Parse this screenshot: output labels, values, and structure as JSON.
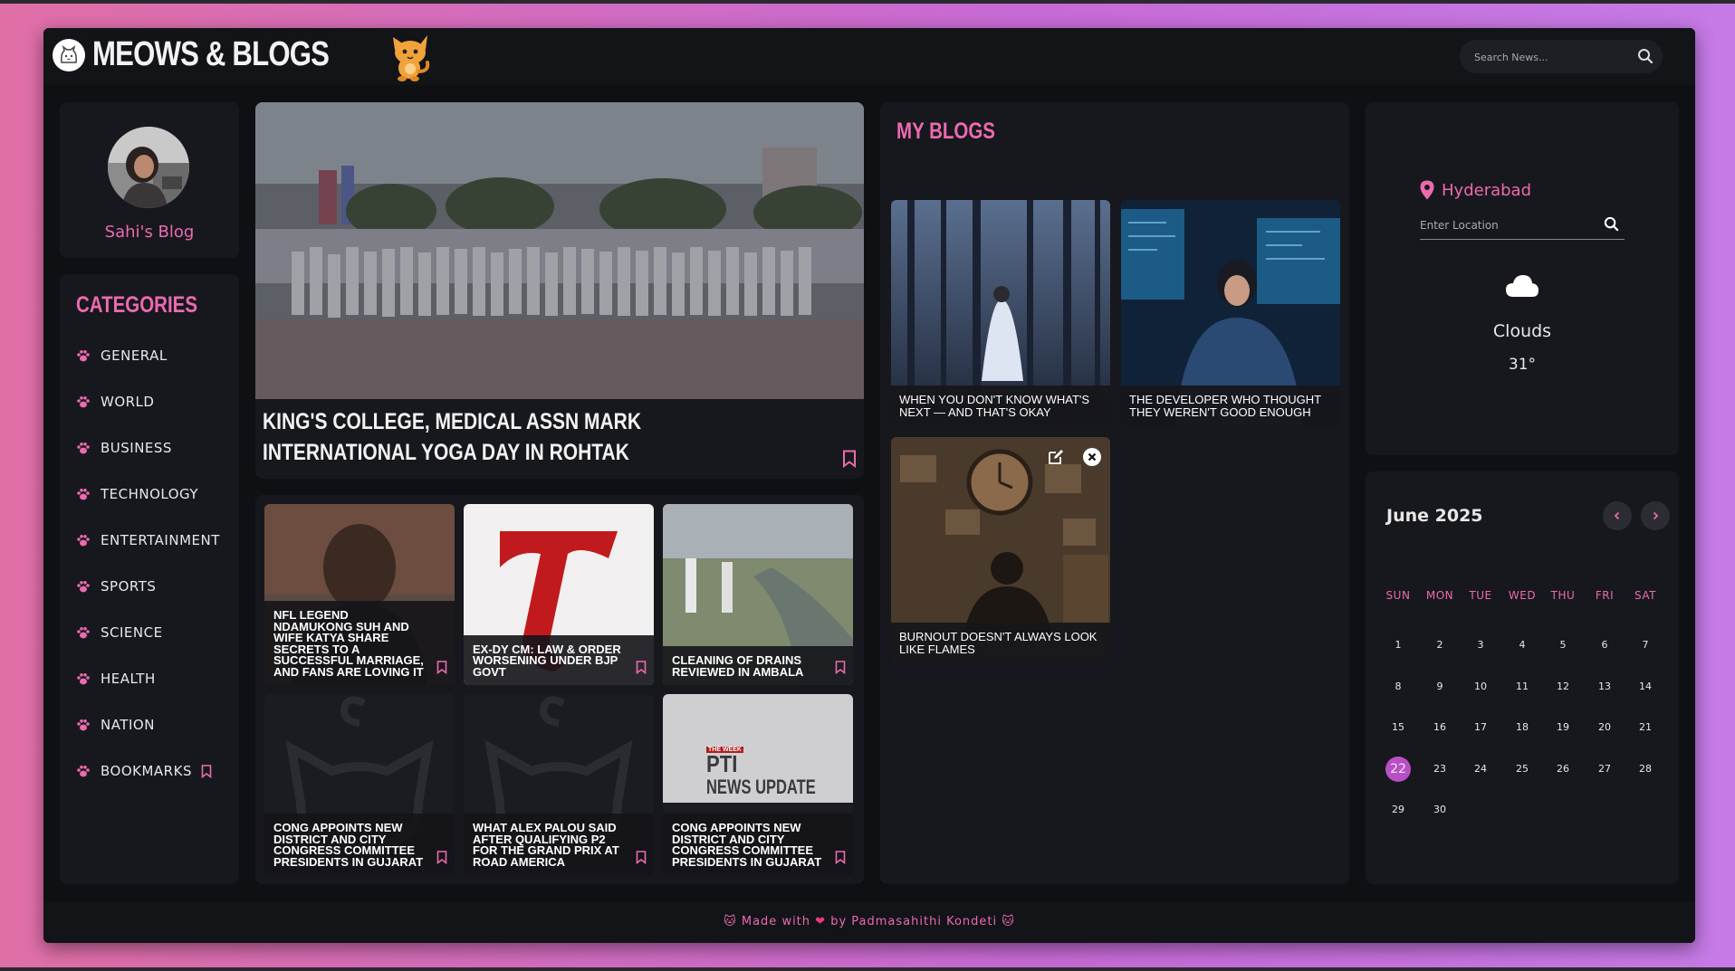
{
  "header": {
    "brand": "MEOWS & BLOGS",
    "search_placeholder": "Search News..."
  },
  "profile": {
    "name": "Sahi's Blog"
  },
  "categories": {
    "title": "CATEGORIES",
    "items": [
      {
        "label": "GENERAL"
      },
      {
        "label": "WORLD"
      },
      {
        "label": "BUSINESS"
      },
      {
        "label": "TECHNOLOGY"
      },
      {
        "label": "ENTERTAINMENT"
      },
      {
        "label": "SPORTS"
      },
      {
        "label": "SCIENCE"
      },
      {
        "label": "HEALTH"
      },
      {
        "label": "NATION"
      },
      {
        "label": "BOOKMARKS"
      }
    ]
  },
  "hero": {
    "title": "KING'S COLLEGE, MEDICAL ASSN MARK INTERNATIONAL YOGA DAY IN ROHTAK"
  },
  "news_cards": [
    {
      "title": "NFL LEGEND NDAMUKONG SUH AND WIFE KATYA SHARE SECRETS TO A SUCCESSFUL MARRIAGE, AND FANS ARE LOVING IT"
    },
    {
      "title": "EX-DY CM: LAW & ORDER WORSENING UNDER BJP GOVT"
    },
    {
      "title": "CLEANING OF DRAINS REVIEWED IN AMBALA"
    },
    {
      "title": "CONG APPOINTS NEW DISTRICT AND CITY CONGRESS COMMITTEE PRESIDENTS IN GUJARAT"
    },
    {
      "title": "WHAT ALEX PALOU SAID AFTER QUALIFYING P2 FOR THE GRAND PRIX AT ROAD AMERICA"
    },
    {
      "title": "CONG APPOINTS NEW DISTRICT AND CITY CONGRESS COMMITTEE PRESIDENTS IN GUJARAT",
      "image_text_top": "THE WEEK",
      "image_text_mid": "PTI",
      "image_text_bottom": "NEWS UPDATE"
    }
  ],
  "blogs": {
    "title": "MY BLOGS",
    "items": [
      {
        "title": "WHEN YOU DON'T KNOW WHAT'S NEXT — AND THAT'S OKAY"
      },
      {
        "title": "THE DEVELOPER WHO THOUGHT THEY WEREN'T GOOD ENOUGH"
      },
      {
        "title": "BURNOUT DOESN'T ALWAYS LOOK LIKE FLAMES"
      }
    ]
  },
  "weather": {
    "location": "Hyderabad",
    "input_placeholder": "Enter Location",
    "condition": "Clouds",
    "temperature": "31°"
  },
  "calendar": {
    "month": "June",
    "year": "2025",
    "weekdays": [
      "SUN",
      "MON",
      "TUE",
      "WED",
      "THU",
      "FRI",
      "SAT"
    ],
    "days": [
      "1",
      "2",
      "3",
      "4",
      "5",
      "6",
      "7",
      "8",
      "9",
      "10",
      "11",
      "12",
      "13",
      "14",
      "15",
      "16",
      "17",
      "18",
      "19",
      "20",
      "21",
      "22",
      "23",
      "24",
      "25",
      "26",
      "27",
      "28",
      "29",
      "30"
    ],
    "today": "22"
  },
  "footer": {
    "prefix": "Made with",
    "suffix": "by Padmasahithi Kondeti"
  },
  "colors": {
    "accent": "#ec6ab0",
    "panel": "#17181d",
    "app_bg": "#0f1013"
  }
}
